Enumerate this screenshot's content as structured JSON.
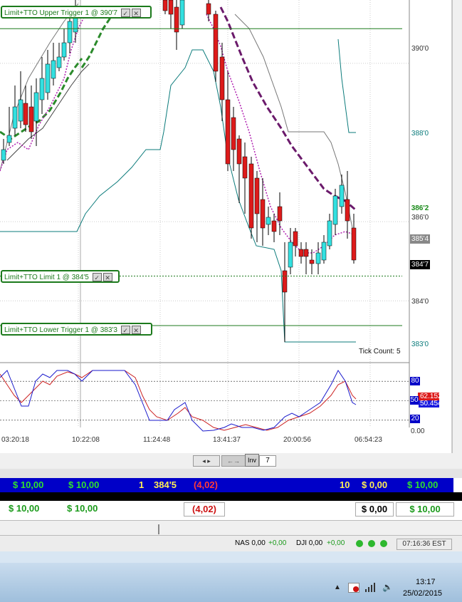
{
  "chart": {
    "order_lines": [
      {
        "label": "Limit+TTO Upper Trigger 1 @ 390'7",
        "price": 390.875
      },
      {
        "label": "Limit+TTO Limit 1 @ 384'5",
        "price": 384.625
      },
      {
        "label": "Limit+TTO Lower Trigger 1 @ 383'3",
        "price": 383.375
      }
    ],
    "price_ticks": [
      {
        "label": "390'0",
        "price": 390.0
      },
      {
        "label": "386'0",
        "price": 386.0
      },
      {
        "label": "384'0",
        "price": 384.0
      }
    ],
    "price_boxes": [
      {
        "label": "388'0",
        "price": 388.0,
        "bg": "#ffffff",
        "fg": "#0b7b7b"
      },
      {
        "label": "386'2",
        "price": 386.25,
        "bg": "#ffffff",
        "fg": "#1a8a1a"
      },
      {
        "label": "385'4",
        "price": 385.5,
        "bg": "#888888",
        "fg": "#ffffff"
      },
      {
        "label": "384'7",
        "price": 384.875,
        "bg": "#000000",
        "fg": "#ffffff"
      },
      {
        "label": "383'0",
        "price": 383.0,
        "bg": "#ffffff",
        "fg": "#0b7b7b"
      }
    ],
    "tick_count": "Tick Count:  5",
    "time_labels": [
      "03:20:18",
      "10:22:08",
      "11:24:48",
      "13:41:37",
      "20:00:56",
      "06:54:23"
    ],
    "stoch_ticks": {
      "top": "80",
      "mid": "50",
      "low": "20",
      "bottom": "0.00"
    },
    "stoch_boxes": {
      "red": "62.1522",
      "blue": "50.4545"
    },
    "tabs": {
      "tab_label": "7",
      "inv_label": "Inv"
    }
  },
  "chart_data": {
    "type": "candlestick",
    "price_axis": {
      "min": 382.6,
      "max": 391.6
    },
    "candles_note": "",
    "candles": [
      [
        388.3,
        388.6,
        388.0,
        388.2
      ],
      [
        388.2,
        388.9,
        388.1,
        388.8
      ],
      [
        388.6,
        389.2,
        388.3,
        388.9
      ],
      [
        388.9,
        389.4,
        388.6,
        388.8
      ],
      [
        388.6,
        389.5,
        388.4,
        389.3
      ],
      [
        389.0,
        389.7,
        388.8,
        389.5
      ],
      [
        389.5,
        390.0,
        389.0,
        389.1
      ],
      [
        389.2,
        389.9,
        389.0,
        389.8
      ],
      [
        389.8,
        390.6,
        389.5,
        390.3
      ],
      [
        390.3,
        390.7,
        389.8,
        390.0
      ],
      [
        390.0,
        390.8,
        389.7,
        390.6
      ],
      [
        390.5,
        391.1,
        390.2,
        390.9
      ]
    ],
    "series": [],
    "stochastic": {
      "ylim": [
        0,
        100
      ],
      "levels": [
        80,
        50,
        20
      ]
    }
  },
  "tab_bar": {
    "nav_prev": "◂",
    "nav_next": "▸"
  },
  "account_row": {
    "col1": "$ 10,00",
    "col2": "$ 10,00",
    "qty": "1",
    "price": "384'5",
    "pnl": "(4,02)",
    "contracts": "10",
    "col_a": "$ 0,00",
    "col_b": "$ 10,00"
  },
  "summary_row": {
    "col1": "$ 10,00",
    "col2": "$ 10,00",
    "pnl": "(4,02)",
    "col_a": "$ 0,00",
    "col_b": "$ 10,00"
  },
  "status_bar": {
    "nas": "NAS 0,00",
    "nas_chg": "+0,00",
    "dji": "DJI 0,00",
    "dji_chg": "+0,00",
    "clock": "07:16:36 EST"
  },
  "taskbar": {
    "time": "13:17",
    "date": "25/02/2015"
  },
  "colors": {
    "bull": "#33e0e0",
    "bear": "#dd1b1b",
    "grid": "#cccccc",
    "green": "#1c7a1c",
    "purple": "#7a1a7a"
  }
}
